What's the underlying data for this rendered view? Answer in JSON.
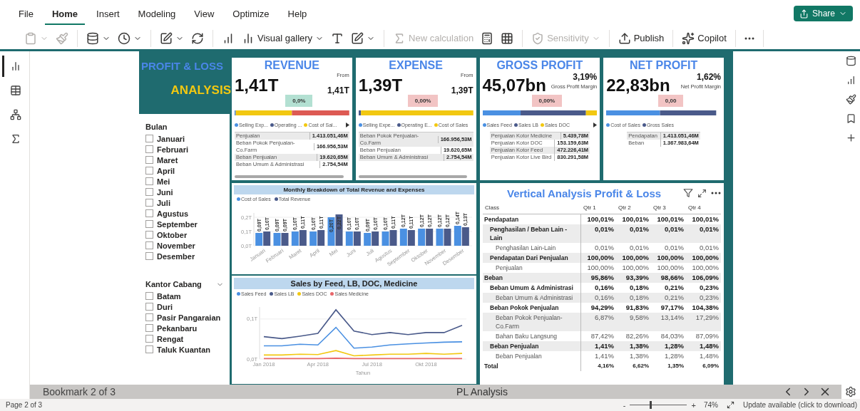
{
  "menu": {
    "tabs": [
      {
        "label": "File",
        "selected": false
      },
      {
        "label": "Home",
        "selected": true
      },
      {
        "label": "Insert",
        "selected": false
      },
      {
        "label": "Modeling",
        "selected": false
      },
      {
        "label": "View",
        "selected": false
      },
      {
        "label": "Optimize",
        "selected": false
      },
      {
        "label": "Help",
        "selected": false
      }
    ],
    "share_button": "Share"
  },
  "toolbar": {
    "groups": [
      {
        "items": [
          {
            "dropdown": true,
            "disabled": true
          },
          {
            "dropdown": false,
            "disabled": true
          }
        ]
      },
      {
        "items": [
          {
            "dropdown": true,
            "disabled": false
          },
          {
            "dropdown": true,
            "disabled": false
          }
        ]
      },
      {
        "items": [
          {
            "dropdown": true,
            "disabled": false
          },
          {
            "dropdown": false,
            "disabled": false
          }
        ]
      },
      {
        "items": [
          {
            "dropdown": false,
            "disabled": false
          },
          {
            "label": "Visual gallery",
            "dropdown": true,
            "disabled": false
          },
          {
            "dropdown": false,
            "disabled": false
          },
          {
            "dropdown": true,
            "disabled": false
          }
        ]
      },
      {
        "items": [
          {
            "label": "New calculation",
            "dropdown": false,
            "disabled": true
          },
          {
            "dropdown": false,
            "disabled": false
          },
          {
            "dropdown": false,
            "disabled": false
          }
        ]
      },
      {
        "items": [
          {
            "label": "Sensitivity",
            "dropdown": true,
            "disabled": true
          }
        ]
      },
      {
        "items": [
          {
            "label": "Publish",
            "dropdown": false,
            "disabled": false
          }
        ]
      },
      {
        "items": [
          {
            "label": "Copilot",
            "dropdown": false,
            "disabled": false
          }
        ]
      },
      {
        "items": [
          {
            "dropdown": false,
            "disabled": false
          }
        ]
      }
    ]
  },
  "left_rail": {
    "views": [
      {
        "selected": true
      },
      {
        "selected": false
      },
      {
        "selected": false
      },
      {
        "selected": false
      }
    ]
  },
  "report": {
    "title": {
      "line_1": "PROFIT & LOSS",
      "line_2": "ANALYSIS"
    },
    "slicers": [
      {
        "title": "Bulan",
        "dropdown": false,
        "items": [
          {
            "label": "Januari",
            "checked": false
          },
          {
            "label": "Februari",
            "checked": false
          },
          {
            "label": "Maret",
            "checked": false
          },
          {
            "label": "April",
            "checked": false
          },
          {
            "label": "Mei",
            "checked": false
          },
          {
            "label": "Juni",
            "checked": false
          },
          {
            "label": "Juli",
            "checked": false
          },
          {
            "label": "Agustus",
            "checked": false
          },
          {
            "label": "September",
            "checked": false
          },
          {
            "label": "Oktober",
            "checked": false
          },
          {
            "label": "November",
            "checked": false
          },
          {
            "label": "Desember",
            "checked": false
          }
        ]
      },
      {
        "title": "Kantor Cabang",
        "dropdown": true,
        "items": [
          {
            "label": "Batam",
            "checked": false
          },
          {
            "label": "Duri",
            "checked": false
          },
          {
            "label": "Pasir Pangaraian",
            "checked": false
          },
          {
            "label": "Pekanbaru",
            "checked": false
          },
          {
            "label": "Rengat",
            "checked": false
          },
          {
            "label": "Taluk Kuantan",
            "checked": false
          }
        ]
      }
    ],
    "kpi_cards": [
      {
        "kind": "comparison",
        "title": "REVENUE",
        "value": "1,41T",
        "compare_label": "From",
        "compare_value": "1,41T",
        "delta": "0,0%",
        "delta_favorable": true,
        "legend": [
          {
            "label": "Selling Exp...",
            "color": "#4a90e2"
          },
          {
            "label": "Operating ...",
            "color": "#4a5a8a"
          },
          {
            "label": "Cost of Sal...",
            "color": "#f2c811"
          }
        ],
        "legend_more": true,
        "scrollbar": true,
        "table": [
          {
            "label": "Penjualan",
            "value": "1.413.051,46M"
          },
          {
            "label": "Beban Pokok Penjualan-Co.Farm",
            "value": "166.956,53M"
          },
          {
            "label": "Beban Penjualan",
            "value": "19.620,65M"
          },
          {
            "label": "Beban Umum & Administrasi",
            "value": "2.754,54M"
          }
        ]
      },
      {
        "kind": "comparison",
        "title": "EXPENSE",
        "value": "1,39T",
        "compare_label": "From",
        "compare_value": "1,39T",
        "delta": "0,00%",
        "delta_favorable": false,
        "legend": [
          {
            "label": "Selling Expe...",
            "color": "#4a90e2"
          },
          {
            "label": "Operating E...",
            "color": "#4a5a8a"
          },
          {
            "label": "Cost of Sales",
            "color": "#f2c811"
          }
        ],
        "legend_more": false,
        "scrollbar": true,
        "table": [
          {
            "label": "Beban Pokok Penjualan-Co.Farm",
            "value": "166.956,53M"
          },
          {
            "label": "Beban Penjualan",
            "value": "19.620,65M"
          },
          {
            "label": "Beban Umum & Administrasi",
            "value": "2.754,54M"
          }
        ]
      },
      {
        "kind": "margin",
        "title": "GROSS PROFIT",
        "value": "45,07bn",
        "compare_label": "Gross Profit Margin",
        "compare_value": "3,19%",
        "delta": "0,00%",
        "delta_favorable": false,
        "legend": [
          {
            "label": "Sales Feed",
            "color": "#4a90e2"
          },
          {
            "label": "Sales LB",
            "color": "#4a5a8a"
          },
          {
            "label": "Sales DOC",
            "color": "#f2c811"
          }
        ],
        "legend_more": true,
        "scrollbar": false,
        "table": [
          {
            "label": "Penjualan Kotor Medicine",
            "value": "5.439,78M"
          },
          {
            "label": "Penjualan Kotor DOC",
            "value": "153.159,63M"
          },
          {
            "label": "Penjualan Kotor Feed",
            "value": "472.226,41M"
          },
          {
            "label": "Penjualan Kotor Live Bird",
            "value": "830.291,58M"
          }
        ]
      },
      {
        "kind": "margin",
        "title": "NET PROFIT",
        "value": "22,83bn",
        "compare_label": "Net Profit Margin",
        "compare_value": "1,62%",
        "delta": "0,00",
        "delta_favorable": false,
        "legend": [
          {
            "label": "Cost of Sales",
            "color": "#4a90e2"
          },
          {
            "label": "Gross Sales",
            "color": "#4a5a8a"
          }
        ],
        "legend_more": false,
        "scrollbar": false,
        "table": [
          {
            "label": "Pendapatan",
            "value": "1.413.051,46M"
          },
          {
            "label": "Beban",
            "value": "1.367.983,64M"
          }
        ]
      }
    ],
    "monthly_chart": {
      "chart_data": {
        "type": "bar",
        "title": "Monthly Breakdown of Total Revenue and Expenses",
        "categories": [
          "Januari",
          "Februari",
          "Maret",
          "April",
          "Mei",
          "Juni",
          "Juli",
          "Agustus",
          "September",
          "Oktober",
          "November",
          "Desember"
        ],
        "series": [
          {
            "name": "Cost of Sales",
            "color": "#4a90e2",
            "values": [
              0.09,
              0.09,
              0.1,
              0.1,
              0.2,
              0.1,
              0.09,
              0.1,
              0.12,
              0.12,
              0.12,
              0.14
            ],
            "value_labels": [
              "0,09T",
              "0,09T",
              "0,10T",
              "0,10T",
              "0,20T",
              "0,10T",
              "0,09T",
              "0,10T",
              "0,12T",
              "0,12T",
              "0,12T",
              "0,14T"
            ]
          },
          {
            "name": "Total Revenue",
            "color": "#4a5a8a",
            "values": [
              0.1,
              0.09,
              0.11,
              0.11,
              0.22,
              0.1,
              0.1,
              0.11,
              0.11,
              0.12,
              0.12,
              0.13
            ],
            "value_labels": [
              "0,10T",
              "0,09T",
              "0,11T",
              "0,11T",
              "0,22T",
              "0,10T",
              "0,10T",
              "0,11T",
              "0,11T",
              "0,12T",
              "0,12T",
              "0,13T"
            ]
          }
        ],
        "ylim": [
          0,
          0.23
        ],
        "yticks": [
          {
            "value": 0,
            "label": "0,0T"
          },
          {
            "value": 0.1,
            "label": "0,1T"
          },
          {
            "value": 0.2,
            "label": "0,2T"
          }
        ],
        "data_labels": true
      }
    },
    "sales_chart": {
      "chart_data": {
        "type": "line",
        "title": "Sales by Feed, LB, DOC, Medicine",
        "xlabel": "Tahun",
        "categories": [
          "Jan 2018",
          null,
          null,
          "Apr 2018",
          null,
          null,
          "Jul 2018",
          null,
          null,
          "Okt 2018",
          null,
          null
        ],
        "series": [
          {
            "name": "Sales Feed",
            "color": "#4a90e2",
            "values": [
              0.033,
              0.033,
              0.037,
              0.035,
              0.079,
              0.027,
              0.03,
              0.035,
              0.038,
              0.04,
              0.042,
              0.043
            ]
          },
          {
            "name": "Sales LB",
            "color": "#4a5a8a",
            "values": [
              0.056,
              0.051,
              0.057,
              0.064,
              0.123,
              0.07,
              0.061,
              0.066,
              0.061,
              0.066,
              0.066,
              0.084
            ]
          },
          {
            "name": "Sales DOC",
            "color": "#f2c811",
            "values": [
              0.01,
              0.01,
              0.012,
              0.011,
              0.021,
              0.008,
              0.01,
              0.012,
              0.012,
              0.014,
              0.012,
              0.014
            ]
          },
          {
            "name": "Sales Medicine",
            "color": "#e8666a",
            "values": [
              0.001,
              0.001,
              0.001,
              0.001,
              0.002,
              0.001,
              0.001,
              0.001,
              0.001,
              0.001,
              0.001,
              0.001
            ]
          }
        ],
        "ylim": [
          0,
          0.13
        ],
        "yticks": [
          {
            "value": 0,
            "label": "0,0T"
          },
          {
            "value": 0.1,
            "label": "0,1T"
          }
        ]
      }
    },
    "matrix": {
      "title": "Vertical Analysis Profit & Loss",
      "columns": [
        "Class",
        "Qtr 1",
        "Qtr 2",
        "Qtr 3",
        "Qtr 4"
      ],
      "rows": [
        {
          "label": "Pendapatan",
          "values": [
            "100,01%",
            "100,01%",
            "100,01%",
            "100,01%"
          ],
          "children": [
            {
              "label": "Penghasilan / Beban Lain - Lain",
              "values": [
                "0,01%",
                "0,01%",
                "0,01%",
                "0,01%"
              ],
              "children": [
                {
                  "label": "Penghasilan Lain-Lain",
                  "values": [
                    "0,01%",
                    "0,01%",
                    "0,01%",
                    "0,01%"
                  ]
                }
              ]
            },
            {
              "label": "Pendapatan Dari Penjualan",
              "values": [
                "100,00%",
                "100,00%",
                "100,00%",
                "100,00%"
              ],
              "children": [
                {
                  "label": "Penjualan",
                  "values": [
                    "100,00%",
                    "100,00%",
                    "100,00%",
                    "100,00%"
                  ]
                }
              ]
            }
          ]
        },
        {
          "label": "Beban",
          "values": [
            "95,86%",
            "93,39%",
            "98,66%",
            "106,09%"
          ],
          "children": [
            {
              "label": "Beban Umum & Administrasi",
              "values": [
                "0,16%",
                "0,18%",
                "0,21%",
                "0,23%"
              ],
              "children": [
                {
                  "label": "Beban Umum & Administrasi",
                  "values": [
                    "0,16%",
                    "0,18%",
                    "0,21%",
                    "0,23%"
                  ]
                }
              ]
            },
            {
              "label": "Beban Pokok Penjualan",
              "values": [
                "94,29%",
                "91,83%",
                "97,17%",
                "104,38%"
              ],
              "children": [
                {
                  "label": "Beban Pokok Penjualan-Co.Farm",
                  "values": [
                    "6,87%",
                    "9,58%",
                    "13,14%",
                    "17,29%"
                  ]
                },
                {
                  "label": "Bahan Baku Langsung",
                  "values": [
                    "87,42%",
                    "82,26%",
                    "84,03%",
                    "87,09%"
                  ]
                }
              ]
            },
            {
              "label": "Beban Penjualan",
              "values": [
                "1,41%",
                "1,38%",
                "1,28%",
                "1,48%"
              ],
              "children": [
                {
                  "label": "Beban Penjualan",
                  "values": [
                    "1,41%",
                    "1,38%",
                    "1,28%",
                    "1,48%"
                  ]
                }
              ]
            }
          ]
        }
      ],
      "total": {
        "label": "Total",
        "values": [
          "4,16%",
          "6,62%",
          "1,35%",
          "6,09%"
        ]
      }
    }
  },
  "bookmark_bar": {
    "label": "Bookmark 2 of 3",
    "page_name": "PL Analysis"
  },
  "status_bar": {
    "page": "Page 2 of 3",
    "zoom_out": "-",
    "zoom_in": "+",
    "zoom_slider": {
      "level": 0.35
    },
    "zoom": "74%",
    "update": "Update available (click to download)"
  }
}
